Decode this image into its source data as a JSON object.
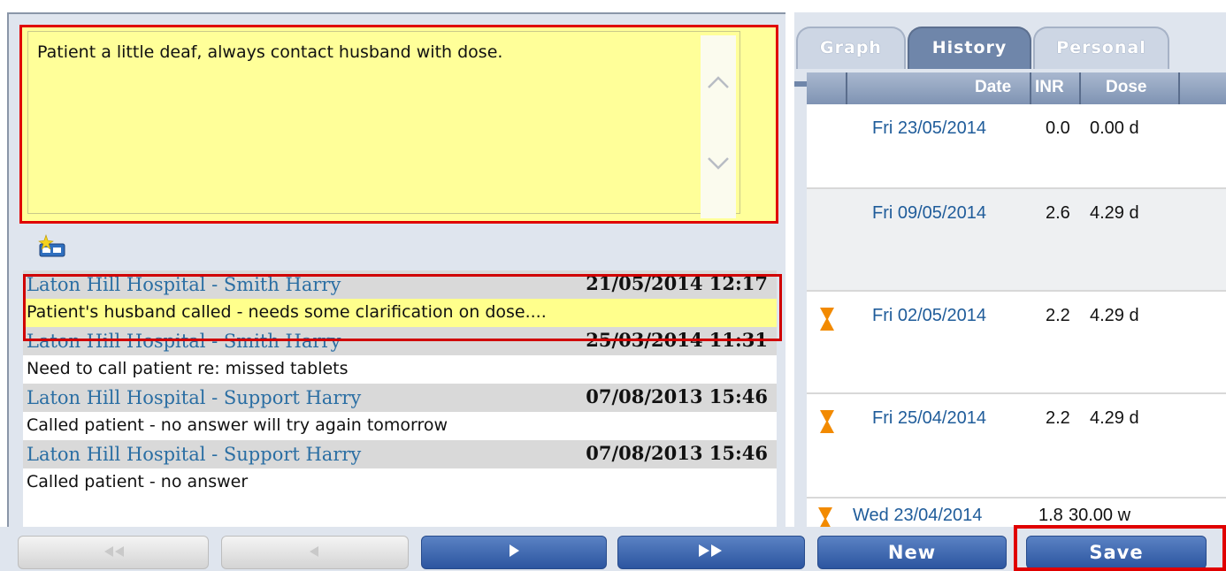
{
  "notes": {
    "current_note": "Patient a little deaf, always contact husband with dose.",
    "entries": [
      {
        "source": "Laton Hill Hospital - Smith Harry",
        "datetime": "21/05/2014 12:17",
        "text": "Patient's husband called - needs some clarification on dose...."
      },
      {
        "source": "Laton Hill Hospital - Smith Harry",
        "datetime": "25/03/2014 11:31",
        "text": "Need to call patient re: missed tablets"
      },
      {
        "source": "Laton Hill Hospital - Support Harry",
        "datetime": "07/08/2013 15:46",
        "text": "Called patient - no answer will try again tomorrow"
      },
      {
        "source": "Laton Hill Hospital - Support Harry",
        "datetime": "07/08/2013 15:46",
        "text": "Called patient - no answer"
      }
    ]
  },
  "tabs": {
    "graph": "Graph",
    "history": "History",
    "personal": "Personal",
    "active": "History"
  },
  "history": {
    "columns": {
      "date": "Date",
      "inr": "INR",
      "dose": "Dose"
    },
    "rows": [
      {
        "date": "Fri 23/05/2014",
        "inr": "0.0",
        "dose": "0.00 d",
        "icon": ""
      },
      {
        "date": "Fri 09/05/2014",
        "inr": "2.6",
        "dose": "4.29 d",
        "icon": ""
      },
      {
        "date": "Fri 02/05/2014",
        "inr": "2.2",
        "dose": "4.29 d",
        "icon": "hourglass-icon"
      },
      {
        "date": "Fri 25/04/2014",
        "inr": "2.2",
        "dose": "4.29 d",
        "icon": "hourglass-icon"
      },
      {
        "date": "Wed 23/04/2014",
        "inr": "1.8",
        "dose": "30.00 w",
        "icon": "hourglass-icon"
      }
    ]
  },
  "buttons": {
    "new": "New",
    "save": "Save"
  },
  "colors": {
    "note_background": "#ffff99",
    "highlight": "#e00000",
    "hourglass": "#f28a00",
    "button_blue": "#2c55a0"
  }
}
